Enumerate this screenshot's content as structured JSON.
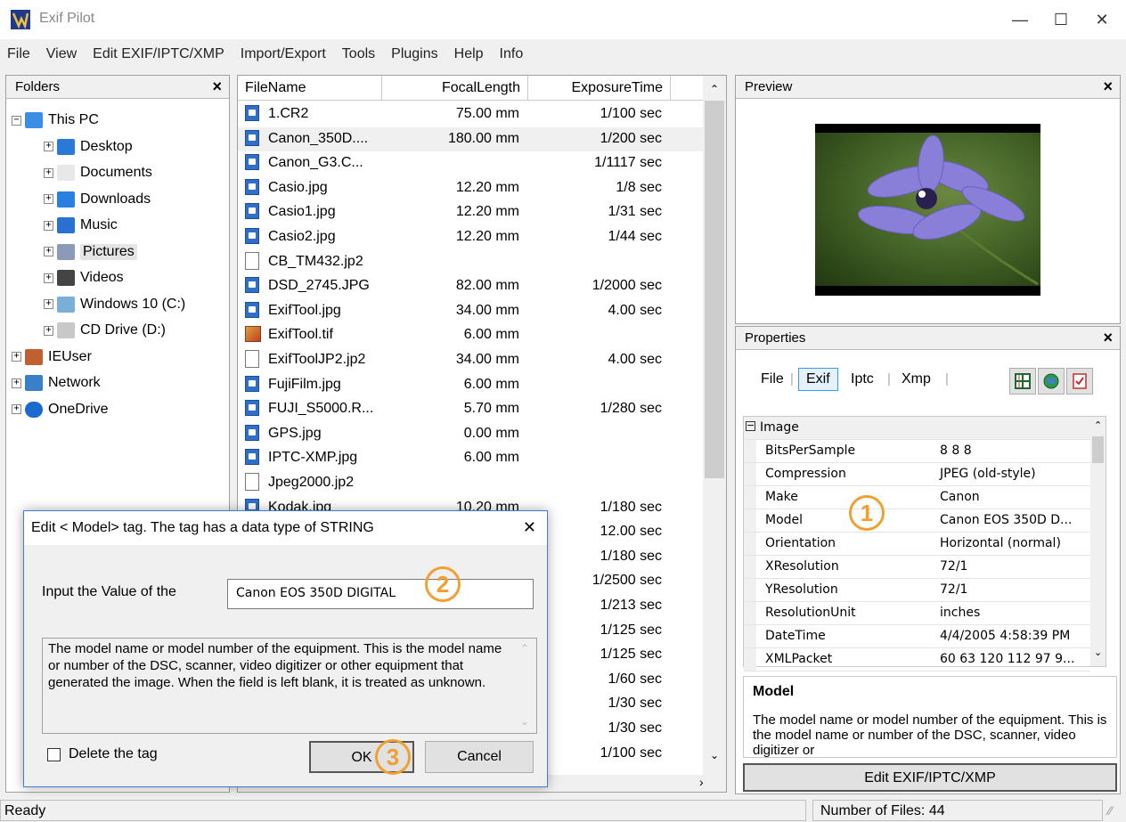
{
  "app": {
    "title": "Exif Pilot"
  },
  "window_controls": {
    "minimize": "—",
    "maximize": "☐",
    "close": "✕"
  },
  "menu": [
    "File",
    "View",
    "Edit EXIF/IPTC/XMP",
    "Import/Export",
    "Tools",
    "Plugins",
    "Help",
    "Info"
  ],
  "folders": {
    "title": "Folders",
    "close": "×",
    "items": [
      {
        "label": "This PC",
        "icon": "monitor-icon",
        "expander": "−"
      },
      {
        "label": "Desktop",
        "icon": "desktop-icon",
        "expander": "+"
      },
      {
        "label": "Documents",
        "icon": "documents-icon",
        "expander": "+"
      },
      {
        "label": "Downloads",
        "icon": "downloads-icon",
        "expander": "+"
      },
      {
        "label": "Music",
        "icon": "music-icon",
        "expander": "+"
      },
      {
        "label": "Pictures",
        "icon": "pictures-icon",
        "expander": "+"
      },
      {
        "label": "Videos",
        "icon": "videos-icon",
        "expander": "+"
      },
      {
        "label": "Windows 10 (C:)",
        "icon": "drive-icon",
        "expander": "+"
      },
      {
        "label": "CD Drive (D:)",
        "icon": "cd-drive-icon",
        "expander": "+"
      },
      {
        "label": "IEUser",
        "icon": "user-icon",
        "expander": "+"
      },
      {
        "label": "Network",
        "icon": "network-icon",
        "expander": "+"
      },
      {
        "label": "OneDrive",
        "icon": "cloud-icon",
        "expander": "+"
      }
    ]
  },
  "filelist": {
    "columns": [
      "FileName",
      "FocalLength",
      "ExposureTime"
    ],
    "rows": [
      {
        "name": "1.CR2",
        "focal": "75.00 mm",
        "exposure": "1/100 sec",
        "icon": "jpg"
      },
      {
        "name": "Canon_350D....",
        "focal": "180.00 mm",
        "exposure": "1/200 sec",
        "icon": "jpg"
      },
      {
        "name": "Canon_G3.C...",
        "focal": "",
        "exposure": "1/1117 sec",
        "icon": "jpg"
      },
      {
        "name": "Casio.jpg",
        "focal": "12.20 mm",
        "exposure": "1/8 sec",
        "icon": "jpg"
      },
      {
        "name": "Casio1.jpg",
        "focal": "12.20 mm",
        "exposure": "1/31 sec",
        "icon": "jpg"
      },
      {
        "name": "Casio2.jpg",
        "focal": "12.20 mm",
        "exposure": "1/44 sec",
        "icon": "jpg"
      },
      {
        "name": "CB_TM432.jp2",
        "focal": "",
        "exposure": "",
        "icon": "doc"
      },
      {
        "name": "DSD_2745.JPG",
        "focal": "82.00 mm",
        "exposure": "1/2000 sec",
        "icon": "jpg"
      },
      {
        "name": "ExifTool.jpg",
        "focal": "34.00 mm",
        "exposure": "4.00 sec",
        "icon": "jpg"
      },
      {
        "name": "ExifTool.tif",
        "focal": "6.00 mm",
        "exposure": "",
        "icon": "tif"
      },
      {
        "name": "ExifToolJP2.jp2",
        "focal": "34.00 mm",
        "exposure": "4.00 sec",
        "icon": "doc"
      },
      {
        "name": "FujiFilm.jpg",
        "focal": "6.00 mm",
        "exposure": "",
        "icon": "jpg"
      },
      {
        "name": "FUJI_S5000.R...",
        "focal": "5.70 mm",
        "exposure": "1/280 sec",
        "icon": "jpg"
      },
      {
        "name": "GPS.jpg",
        "focal": "0.00 mm",
        "exposure": "",
        "icon": "jpg"
      },
      {
        "name": "IPTC-XMP.jpg",
        "focal": "6.00 mm",
        "exposure": "",
        "icon": "jpg"
      },
      {
        "name": "Jpeg2000.jp2",
        "focal": "",
        "exposure": "",
        "icon": "doc"
      },
      {
        "name": "Kodak.jpg",
        "focal": "10.20 mm",
        "exposure": "1/180 sec",
        "icon": "jpg"
      },
      {
        "name": "",
        "focal": "",
        "exposure": "12.00 sec",
        "icon": ""
      },
      {
        "name": "",
        "focal": "",
        "exposure": "1/180 sec",
        "icon": ""
      },
      {
        "name": "",
        "focal": "",
        "exposure": "1/2500 sec",
        "icon": ""
      },
      {
        "name": "",
        "focal": "",
        "exposure": "1/213 sec",
        "icon": ""
      },
      {
        "name": "",
        "focal": "",
        "exposure": "1/125 sec",
        "icon": ""
      },
      {
        "name": "",
        "focal": "",
        "exposure": "1/125 sec",
        "icon": ""
      },
      {
        "name": "",
        "focal": "",
        "exposure": "1/60 sec",
        "icon": ""
      },
      {
        "name": "",
        "focal": "",
        "exposure": "1/30 sec",
        "icon": ""
      },
      {
        "name": "",
        "focal": "",
        "exposure": "1/30 sec",
        "icon": ""
      },
      {
        "name": "",
        "focal": "",
        "exposure": "1/100 sec",
        "icon": ""
      }
    ]
  },
  "preview": {
    "title": "Preview",
    "close": "×"
  },
  "properties": {
    "title": "Properties",
    "close": "×",
    "tabs": [
      "File",
      "Exif",
      "Iptc",
      "Xmp"
    ],
    "active_tab": "Exif",
    "group": "Image",
    "rows": [
      {
        "name": "BitsPerSample",
        "value": "8 8 8"
      },
      {
        "name": "Compression",
        "value": "JPEG (old-style)"
      },
      {
        "name": "Make",
        "value": "Canon"
      },
      {
        "name": "Model",
        "value": "Canon EOS 350D D..."
      },
      {
        "name": "Orientation",
        "value": "Horizontal (normal)"
      },
      {
        "name": "XResolution",
        "value": "72/1"
      },
      {
        "name": "YResolution",
        "value": "72/1"
      },
      {
        "name": "ResolutionUnit",
        "value": "inches"
      },
      {
        "name": "DateTime",
        "value": "4/4/2005 4:58:39 PM"
      },
      {
        "name": "XMLPacket",
        "value": "60 63 120 112 97 9..."
      }
    ],
    "desc_title": "Model",
    "desc_text": "The model name or model number of the equipment. This is the model name or number of the DSC, scanner, video digitizer or",
    "edit_button": "Edit EXIF/IPTC/XMP"
  },
  "dialog": {
    "title": "Edit < Model> tag. The tag has a data type of STRING",
    "close": "✕",
    "input_label": "Input the Value of the",
    "input_value": "Canon EOS 350D DIGITAL",
    "description": "The model name or model number of the equipment. This is the model name or number of the DSC, scanner, video digitizer or other equipment that generated the image. When the field is left blank, it is treated as unknown.",
    "delete_label": "Delete the tag",
    "ok": "OK",
    "cancel": "Cancel"
  },
  "callouts": [
    "1",
    "2",
    "3"
  ],
  "status": {
    "left": "Ready",
    "right": "Number of Files: 44"
  },
  "colors": {
    "accent": "#f0a030",
    "selection": "#3399ff",
    "dialog_border": "#3f7fd0"
  }
}
